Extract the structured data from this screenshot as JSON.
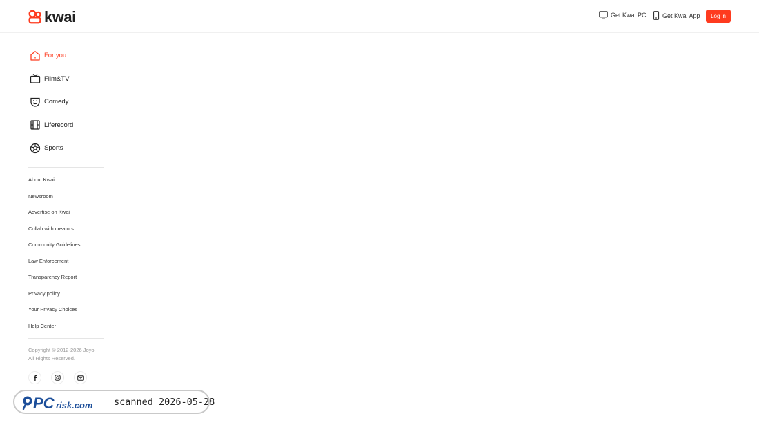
{
  "header": {
    "logo_text": "kwai",
    "get_pc_label": "Get Kwai PC",
    "get_app_label": "Get Kwai App",
    "login_label": "Log in"
  },
  "nav": {
    "items": [
      {
        "label": "For you",
        "icon": "home-icon",
        "active": true
      },
      {
        "label": "Film&TV",
        "icon": "tv-icon",
        "active": false
      },
      {
        "label": "Comedy",
        "icon": "mask-icon",
        "active": false
      },
      {
        "label": "Liferecord",
        "icon": "film-icon",
        "active": false
      },
      {
        "label": "Sports",
        "icon": "soccer-ball-icon",
        "active": false
      }
    ]
  },
  "footer_links": [
    "About Kwai",
    "Newsroom",
    "Advertise on Kwai",
    "Collab with creators",
    "Community Guidelines",
    "Law Enforcement",
    "Transparency Report",
    "Privacy policy",
    "Your Privacy Choices",
    "Help Center"
  ],
  "copyright": {
    "line1": "Copyright © 2012-2026 Joyo.",
    "line2": "All Rights Reserved."
  },
  "social": [
    "facebook-icon",
    "instagram-icon",
    "email-icon"
  ],
  "watermark": {
    "brand": "PCrisk.com",
    "text": "scanned 2026-05-28"
  },
  "colors": {
    "accent": "#fe3b1f",
    "text": "#222222",
    "muted": "#999999"
  }
}
